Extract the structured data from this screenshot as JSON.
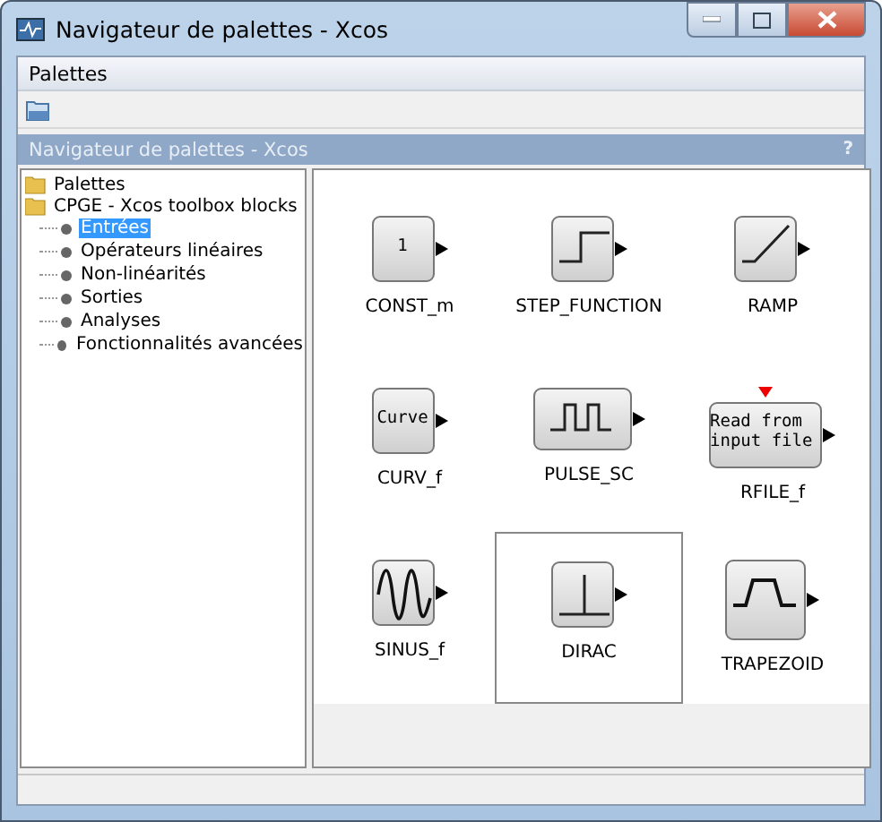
{
  "window": {
    "title": "Navigateur de palettes - Xcos"
  },
  "menu": [
    "Palettes"
  ],
  "panel": {
    "title": "Navigateur de palettes - Xcos",
    "help": "?"
  },
  "tree": [
    {
      "label": "Palettes",
      "children": [
        {
          "label": "CPGE - Xcos toolbox blocks",
          "children": [
            {
              "label": "Entrées",
              "selected": true
            },
            {
              "label": "Opérateurs linéaires",
              "selected": false
            },
            {
              "label": "Non-linéarités",
              "selected": false
            },
            {
              "label": "Sorties",
              "selected": false
            },
            {
              "label": "Analyses",
              "selected": false
            },
            {
              "label": "Fonctionnalités avancées",
              "selected": false
            }
          ]
        }
      ]
    }
  ],
  "blocks": [
    {
      "kind": "const",
      "text": "1",
      "name": "CONST_m",
      "selected": false
    },
    {
      "kind": "step",
      "name": "STEP_FUNCTION",
      "selected": false
    },
    {
      "kind": "ramp",
      "name": "RAMP",
      "selected": false
    },
    {
      "kind": "curve",
      "text": "Curve",
      "name": "CURV_f",
      "selected": false
    },
    {
      "kind": "pulse",
      "name": "PULSE_SC",
      "selected": false
    },
    {
      "kind": "rfile",
      "text": "Read from input file",
      "name": "RFILE_f",
      "selected": false
    },
    {
      "kind": "sinus",
      "name": "SINUS_f",
      "selected": false
    },
    {
      "kind": "dirac",
      "name": "DIRAC",
      "selected": true
    },
    {
      "kind": "trapezoid",
      "name": "TRAPEZOID",
      "selected": false
    }
  ]
}
